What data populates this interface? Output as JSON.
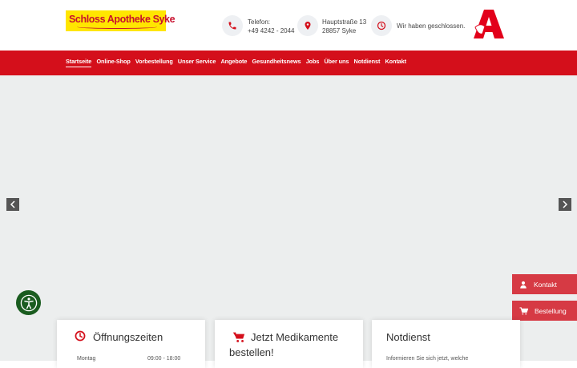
{
  "header": {
    "logo_text": "Schloss Apotheke Syke",
    "phone_label": "Telefon:",
    "phone_number": "+49 4242 - 2044",
    "address_street": "Hauptstraße 13",
    "address_city": "28857 Syke",
    "status_text": "Wir haben geschlossen."
  },
  "nav": {
    "items": [
      "Startseite",
      "Online-Shop",
      "Vorbestellung",
      "Unser Service",
      "Angebote",
      "Gesundheitsnews",
      "Jobs",
      "Über uns",
      "Notdienst",
      "Kontakt"
    ]
  },
  "floating": {
    "kontakt_label": "Kontakt",
    "bestellung_label": "Bestellung"
  },
  "cards": {
    "hours_title": "Öffnungszeiten",
    "hours_day": "Montag",
    "hours_time": "09:00 - 18:00",
    "order_title_line1": "Jetzt Medikamente",
    "order_title_line2": "bestellen!",
    "notdienst_title": "Notdienst",
    "notdienst_text": "Informieren Sie sich jetzt, welche"
  },
  "colors": {
    "brand_red": "#d40f1b",
    "logo_yellow": "#ffe600",
    "accessibility_green": "#1a5c1f"
  }
}
